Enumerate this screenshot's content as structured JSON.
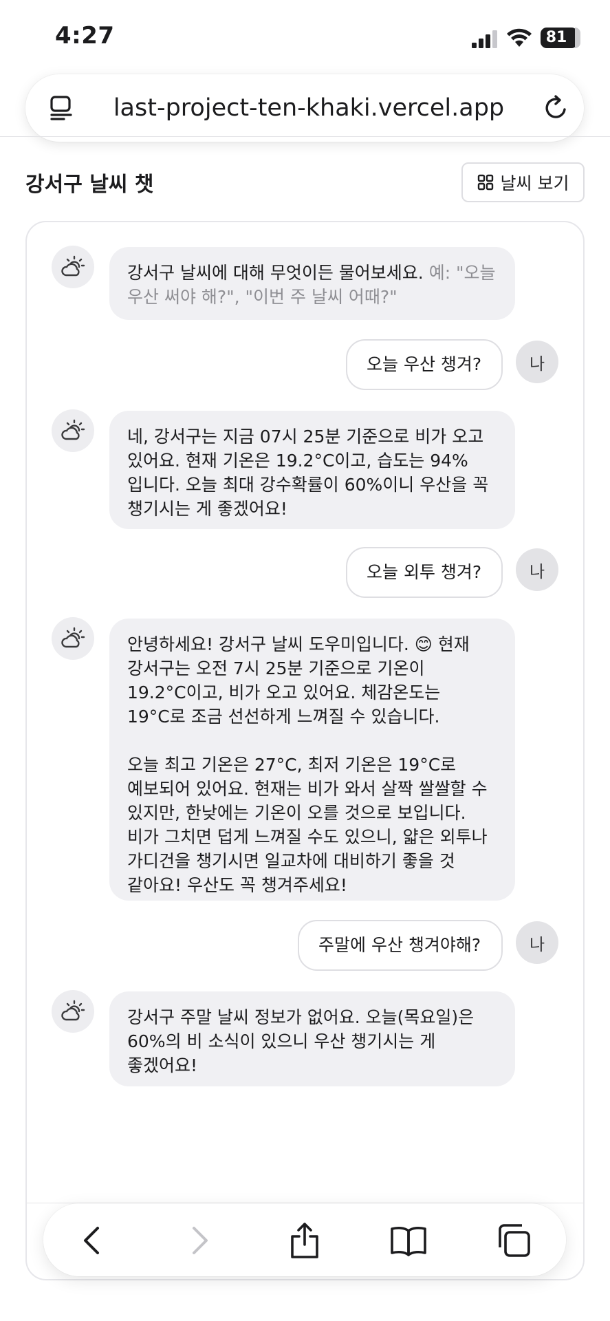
{
  "status_bar": {
    "time": "4:27",
    "battery_level": "81",
    "icons": [
      "signal-icon",
      "wifi-icon",
      "battery-icon"
    ]
  },
  "browser": {
    "url": "last-project-ten-khaki.vercel.app",
    "icons": [
      "tabs-overview-icon",
      "reload-icon"
    ]
  },
  "header": {
    "title": "강서구 날씨 챗",
    "weather_button_label": "날씨 보기",
    "weather_button_icon": "grid-icon"
  },
  "messages": [
    {
      "role": "assistant",
      "text": "강서구 날씨에 대해 무엇이든 물어보세요. ",
      "hint": "예: \"오늘 우산 써야 해?\", \"이번 주 날씨 어때?\""
    },
    {
      "role": "user",
      "avatar": "나",
      "text": "오늘 우산 챙겨?"
    },
    {
      "role": "assistant",
      "text": "네, 강서구는 지금 07시 25분 기준으로 비가 오고 있어요. 현재 기온은 19.2°C이고, 습도는 94%입니다. 오늘 최대 강수확률이 60%이니 우산을 꼭 챙기시는 게 좋겠어요!"
    },
    {
      "role": "user",
      "avatar": "나",
      "text": "오늘 외투 챙겨?"
    },
    {
      "role": "assistant",
      "text": "안녕하세요! 강서구 날씨 도우미입니다. 😊 현재 강서구는 오전 7시 25분 기준으로 기온이 19.2°C이고, 비가 오고 있어요. 체감온도는 19°C로 조금 선선하게 느껴질 수 있습니다.\n\n오늘 최고 기온은 27°C, 최저 기온은 19°C로 예보되어 있어요. 현재는 비가 와서 살짝 쌀쌀할 수 있지만, 한낮에는 기온이 오를 것으로 보입니다. 비가 그치면 덥게 느껴질 수도 있으니, 얇은 외투나 가디건을 챙기시면 일교차에 대비하기 좋을 것 같아요! 우산도 꼭 챙겨주세요!"
    },
    {
      "role": "user",
      "avatar": "나",
      "text": "주말에 우산 챙겨야해?"
    },
    {
      "role": "assistant",
      "text": "강서구 주말 날씨 정보가 없어요. 오늘(목요일)은 60%의 비 소식이 있으니 우산 챙기시는 게 좋겠어요!"
    }
  ],
  "bot_avatar_icon": "cloud-sun-icon",
  "toolbar": {
    "items": [
      "back-icon",
      "forward-icon",
      "share-icon",
      "bookmarks-icon",
      "tabs-icon"
    ]
  }
}
